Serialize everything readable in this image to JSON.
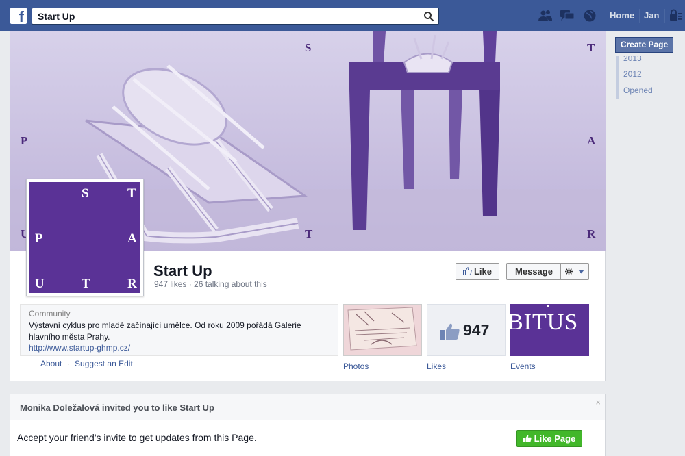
{
  "topbar": {
    "logo_letter": "f",
    "search_value": "Start Up",
    "nav_home": "Home",
    "nav_user": "Jan"
  },
  "right_column": {
    "create_page_label": "Create Page",
    "timeline_years": [
      "2013",
      "2012",
      "Opened"
    ]
  },
  "cover": {
    "letters": {
      "s": "S",
      "t_top": "T",
      "p": "P",
      "a": "A",
      "t_bottom": "T",
      "r": "R",
      "u": "U"
    }
  },
  "profile_pic": {
    "letters": [
      "S",
      "T",
      "P",
      "A",
      "U",
      "T",
      "R"
    ]
  },
  "page": {
    "name": "Start Up",
    "stats": "947 likes · 26 talking about this",
    "like_button": "Like",
    "message_button": "Message"
  },
  "about": {
    "category": "Community",
    "description": "Výstavní cyklus pro mladé začínající umělce. Od roku 2009 pořádá Galerie hlavního města Prahy.",
    "url": "http://www.startup-ghmp.cz/",
    "link_about": "About",
    "separator": "·",
    "link_suggest": "Suggest an Edit"
  },
  "tiles": {
    "photos_label": "Photos",
    "likes_count": "947",
    "likes_label": "Likes",
    "events_image_text": "BITUS",
    "events_label": "Events"
  },
  "invite": {
    "title": "Monika Doležalová invited you to like Start Up",
    "close": "×",
    "body": "Accept your friend's invite to get updates from this Page.",
    "button_label": "Like Page"
  },
  "colors": {
    "brand_blue": "#3b5998",
    "purple": "#5a3296",
    "green": "#42b72a"
  }
}
